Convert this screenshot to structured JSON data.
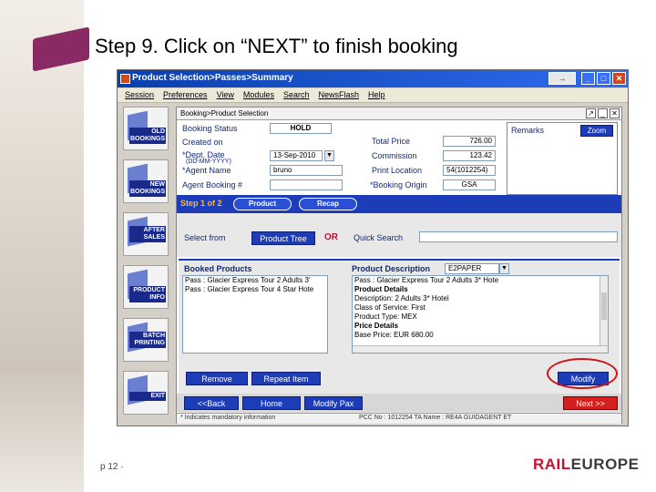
{
  "slide": {
    "title_step": "Step 9.",
    "title_text": "Click on “NEXT” to finish booking",
    "page_number": "p 12 ·",
    "brand_left": "RAIL",
    "brand_right": "EUROPE"
  },
  "window": {
    "title": "Product Selection>Passes>Summary",
    "menu": [
      "Session",
      "Preferences",
      "View",
      "Modules",
      "Search",
      "NewsFlash",
      "Help"
    ]
  },
  "sidebar": {
    "items": [
      {
        "label": "OLD BOOKINGS"
      },
      {
        "label": "NEW BOOKINGS"
      },
      {
        "label": "AFTER SALES"
      },
      {
        "label": "PRODUCT INFO"
      },
      {
        "label": "BATCH PRINTING"
      },
      {
        "label": "EXIT"
      }
    ]
  },
  "panel": {
    "title": "Booking>Product Selection",
    "booking_status_label": "Booking Status",
    "booking_status_value": "HOLD",
    "created_on_label": "Created on",
    "dept_date_label": "*Dept. Date",
    "dept_date_hint": "(DD-MM-YYYY)",
    "dept_date_value": "13-Sep-2010",
    "agent_name_label": "*Agent Name",
    "agent_name_value": "bruno",
    "agent_booking_label": "Agent Booking #",
    "total_price_label": "Total Price",
    "total_price_value": "726.00",
    "commission_label": "Commission",
    "commission_value": "123.42",
    "print_location_label": "Print Location",
    "print_location_value": "54(1012254)",
    "booking_origin_label": "*Booking Origin",
    "booking_origin_value": "GSA",
    "remarks_label": "Remarks",
    "zoom_label": "Zoom"
  },
  "steps": {
    "step_text": "Step 1 of 2",
    "product_tab": "Product",
    "recap_tab": "Recap"
  },
  "select": {
    "select_from_label": "Select from",
    "product_tree_button": "Product Tree",
    "or_text": "OR",
    "quick_search_label": "Quick Search",
    "quick_search_value": ""
  },
  "booked": {
    "booked_products_label": "Booked Products",
    "items": [
      "Pass : Glacier Express Tour 2 Adults 3'",
      "Pass : Glacier Express Tour 4 Star Hote"
    ],
    "product_description_label": "Product Description",
    "product_description_value": "E2PAPER",
    "description_lines": [
      "Pass : Glacier Express Tour 2 Adults 3* Hote",
      "Product Details",
      "Description: 2 Adults 3* Hotel",
      "Class of Service: First",
      "Product Type: MEX",
      "Price Details",
      "Base Price: EUR 680.00"
    ],
    "remove_button": "Remove",
    "repeat_item_button": "Repeat Item",
    "modify_button": "Modify"
  },
  "nav": {
    "back_button": "<<Back",
    "home_button": "Home",
    "modify_pax_button": "Modify Pax",
    "next_button": "Next >>"
  },
  "status": {
    "left": "* Indicates mandatory information",
    "right": "PCC No : 1012254 TA Name : RE4A GUIDAGENT ET"
  },
  "colors": {
    "accent_blue": "#1d3db8",
    "next_red": "#d41f1f",
    "highlight_red": "#d01212",
    "brand_magenta": "#8a2a64"
  }
}
